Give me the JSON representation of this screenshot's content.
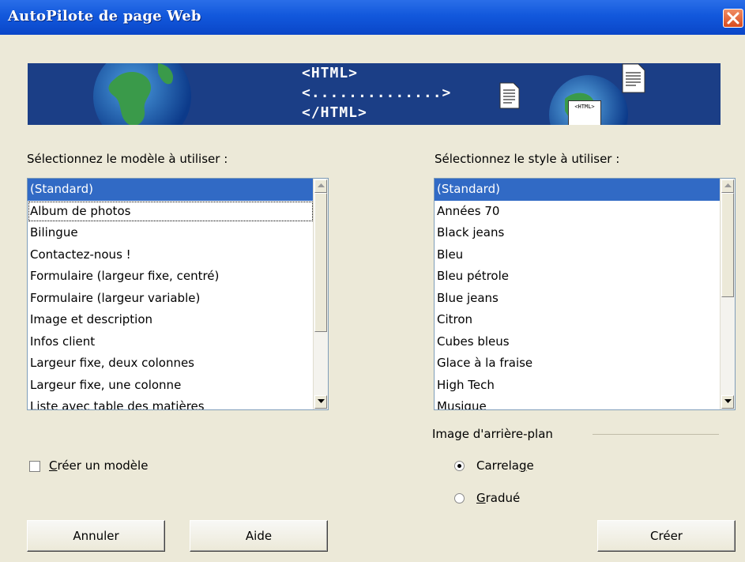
{
  "window": {
    "title": "AutoPilote de page Web"
  },
  "banner": {
    "line1": "<HTML>",
    "line2": "<..............>",
    "line3": "</HTML>",
    "doc_label": "<HTML>"
  },
  "templates": {
    "label": "Sélectionnez le modèle à utiliser :",
    "items": [
      "(Standard)",
      "Album de photos",
      "Bilingue",
      "Contactez-nous !",
      "Formulaire (largeur fixe, centré)",
      "Formulaire (largeur variable)",
      "Image et description",
      "Infos client",
      "Largeur fixe, deux colonnes",
      "Largeur fixe, une colonne",
      "Liste avec table des matières"
    ],
    "selected_index": 0,
    "focused_index": 1
  },
  "styles": {
    "label": "Sélectionnez le style à utiliser :",
    "items": [
      "(Standard)",
      "Années 70",
      "Black jeans",
      "Bleu",
      "Bleu pétrole",
      "Blue jeans",
      "Citron",
      "Cubes bleus",
      "Glace à la fraise",
      "High Tech",
      "Musique"
    ],
    "selected_index": 0
  },
  "create_template": {
    "label_mnemonic": "C",
    "label_rest": "réer un modèle",
    "checked": false
  },
  "background_image": {
    "label": "Image d'arrière-plan",
    "options": [
      {
        "prefix": "Carrela",
        "mnemonic": "g",
        "suffix": "e",
        "selected": true
      },
      {
        "prefix": "",
        "mnemonic": "G",
        "suffix": "radué",
        "selected": false
      }
    ]
  },
  "buttons": {
    "cancel": "Annuler",
    "help": "Aide",
    "create": "Créer"
  },
  "colors": {
    "titlebar": "#0a46c8",
    "banner": "#1b3e86",
    "selection": "#316ac5",
    "dialog": "#ece9d8"
  },
  "icons": [
    "close-icon",
    "globe-icon",
    "document-icon",
    "scroll-up-icon",
    "scroll-down-icon"
  ]
}
